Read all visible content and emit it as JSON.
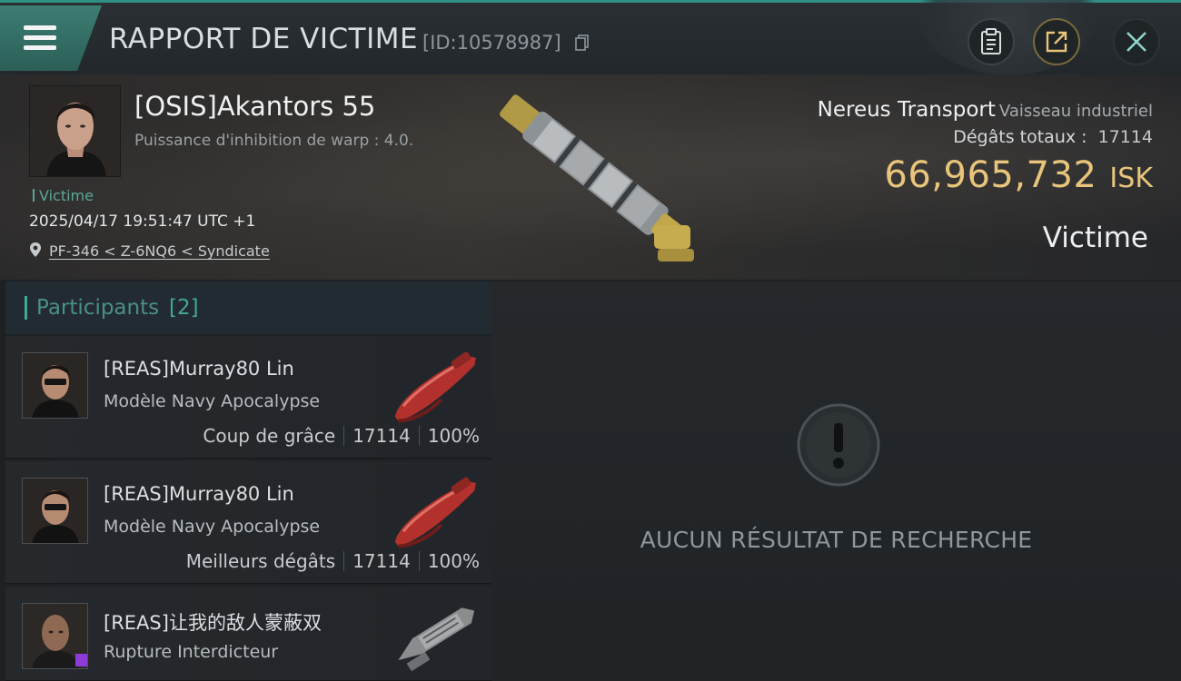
{
  "header": {
    "title": "RAPPORT DE VICTIME",
    "report_id": "[ID:10578987]"
  },
  "victim": {
    "name": "[OSIS]Akantors 55",
    "subtitle": "Puissance d'inhibition de warp : 4.0.",
    "tag": "Victime",
    "datetime": "2025/04/17 19:51:47 UTC +1",
    "location": "PF-346 < Z-6NQ6 < Syndicate",
    "ship_name": "Nereus Transport",
    "ship_class": "Vaisseau industriel",
    "total_damage_label": "Dégâts totaux :",
    "total_damage": "17114",
    "isk_value": "66,965,732",
    "isk_unit": "ISK",
    "role_label": "Victime"
  },
  "participants": {
    "title": "Participants",
    "count": "[2]",
    "items": [
      {
        "name": "[REAS]Murray80 Lin",
        "ship": "Modèle Navy Apocalypse",
        "role": "Coup de grâce",
        "damage": "17114",
        "percent": "100%"
      },
      {
        "name": "[REAS]Murray80 Lin",
        "ship": "Modèle Navy Apocalypse",
        "role": "Meilleurs dégâts",
        "damage": "17114",
        "percent": "100%"
      },
      {
        "name": "[REAS]让我的敌人蒙蔽双",
        "ship": "Rupture Interdicteur"
      }
    ]
  },
  "empty_state": {
    "text": "AUCUN RÉSULTAT DE RECHERCHE"
  },
  "icons": {
    "menu": "menu-icon",
    "copy": "copy-icon",
    "clipboard": "clipboard-icon",
    "share": "share-icon",
    "close": "close-icon",
    "location": "location-pin-icon",
    "alert": "exclamation-icon"
  },
  "colors": {
    "accent_teal": "#3fa898",
    "isk_gold": "#e8c57a",
    "menu_bg": "#3d7d72"
  }
}
